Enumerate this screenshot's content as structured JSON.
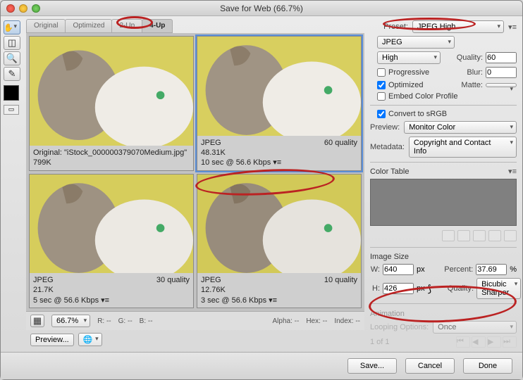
{
  "title": "Save for Web (66.7%)",
  "tabs": [
    "Original",
    "Optimized",
    "2-Up",
    "4-Up"
  ],
  "active_tab": "4-Up",
  "previews": [
    {
      "label_a": "Original: \"iStock_000000379070Medium.jpg\"",
      "label_b": "",
      "size": "799K",
      "time": ""
    },
    {
      "label_a": "JPEG",
      "label_b": "60 quality",
      "size": "48.31K",
      "time": "10 sec @ 56.6 Kbps  ▾≡"
    },
    {
      "label_a": "JPEG",
      "label_b": "30 quality",
      "size": "21.7K",
      "time": "5 sec @ 56.6 Kbps  ▾≡"
    },
    {
      "label_a": "JPEG",
      "label_b": "10 quality",
      "size": "12.76K",
      "time": "3 sec @ 56.6 Kbps  ▾≡"
    }
  ],
  "bottombar": {
    "zoom": "66.7%",
    "r": "R: --",
    "g": "G: --",
    "b": "B: --",
    "alpha": "Alpha: --",
    "hex": "Hex: --",
    "index": "Index: --"
  },
  "preview_btn": "Preview...",
  "footer": {
    "save": "Save...",
    "cancel": "Cancel",
    "done": "Done"
  },
  "side": {
    "preset_label": "Preset:",
    "preset": "JPEG High",
    "format": "JPEG",
    "quality_level": "High",
    "quality_label": "Quality:",
    "quality": "60",
    "progressive": "Progressive",
    "blur_label": "Blur:",
    "blur": "0",
    "optimized": "Optimized",
    "matte_label": "Matte:",
    "matte": "",
    "embed": "Embed Color Profile",
    "srgb": "Convert to sRGB",
    "preview_label": "Preview:",
    "preview": "Monitor Color",
    "metadata_label": "Metadata:",
    "metadata": "Copyright and Contact Info",
    "color_table": "Color Table",
    "image_size": "Image Size",
    "w_label": "W:",
    "w": "640",
    "px": "px",
    "h_label": "H:",
    "h": "426",
    "percent_label": "Percent:",
    "percent": "37.69",
    "pct": "%",
    "is_quality_label": "Quality:",
    "is_quality": "Bicubic Sharper",
    "animation": "Animation",
    "loop_label": "Looping Options:",
    "loop": "Once",
    "frame": "1 of 1"
  },
  "chart_data": null
}
